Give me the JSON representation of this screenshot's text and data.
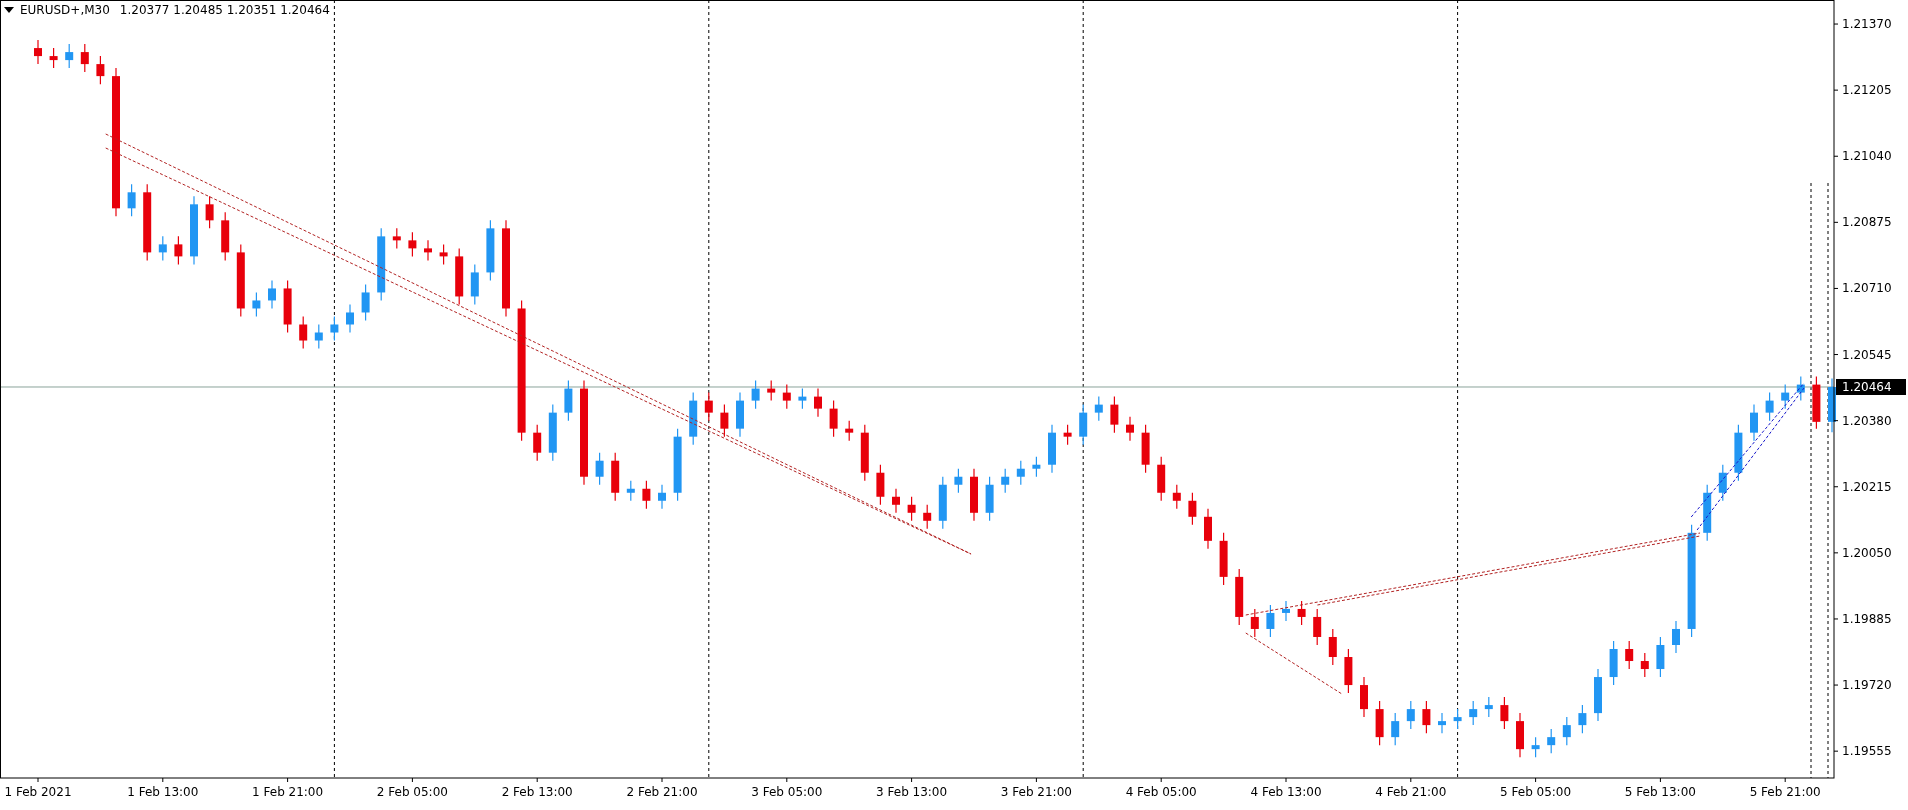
{
  "header": {
    "symbol": "EURUSD+,M30",
    "quotes": "1.20377 1.20485 1.20351 1.20464"
  },
  "chart_data": {
    "type": "candlestick",
    "ylim": [
      1.19488,
      1.2143
    ],
    "yticks": [
      {
        "value": 1.2137,
        "label": "1.21370"
      },
      {
        "value": 1.21205,
        "label": "1.21205"
      },
      {
        "value": 1.2104,
        "label": "1.21040"
      },
      {
        "value": 1.20875,
        "label": "1.20875"
      },
      {
        "value": 1.2071,
        "label": "1.20710"
      },
      {
        "value": 1.20545,
        "label": "1.20545"
      },
      {
        "value": 1.2038,
        "label": "1.20380"
      },
      {
        "value": 1.20215,
        "label": "1.20215"
      },
      {
        "value": 1.2005,
        "label": "1.20050"
      },
      {
        "value": 1.19885,
        "label": "1.19885"
      },
      {
        "value": 1.1972,
        "label": "1.19720"
      },
      {
        "value": 1.19555,
        "label": "1.19555"
      }
    ],
    "categories": [
      "1 Feb 2021",
      null,
      null,
      null,
      null,
      null,
      null,
      null,
      "1 Feb 13:00",
      null,
      null,
      null,
      null,
      null,
      null,
      null,
      "1 Feb 21:00",
      null,
      null,
      null,
      null,
      null,
      null,
      null,
      "2 Feb 05:00",
      null,
      null,
      null,
      null,
      null,
      null,
      null,
      "2 Feb 13:00",
      null,
      null,
      null,
      null,
      null,
      null,
      null,
      "2 Feb 21:00",
      null,
      null,
      null,
      null,
      null,
      null,
      null,
      "3 Feb 05:00",
      null,
      null,
      null,
      null,
      null,
      null,
      null,
      "3 Feb 13:00",
      null,
      null,
      null,
      null,
      null,
      null,
      null,
      "3 Feb 21:00",
      null,
      null,
      null,
      null,
      null,
      null,
      null,
      "4 Feb 05:00",
      null,
      null,
      null,
      null,
      null,
      null,
      null,
      "4 Feb 13:00",
      null,
      null,
      null,
      null,
      null,
      null,
      null,
      "4 Feb 21:00",
      null,
      null,
      null,
      null,
      null,
      null,
      null,
      "5 Feb 05:00",
      null,
      null,
      null,
      null,
      null,
      null,
      null,
      "5 Feb 13:00",
      null,
      null,
      null,
      null,
      null,
      null,
      null,
      "5 Feb 21:00",
      null,
      null,
      null
    ],
    "ohlc": [
      [
        1.2131,
        1.2133,
        1.2127,
        1.2129
      ],
      [
        1.2129,
        1.2131,
        1.2126,
        1.2128
      ],
      [
        1.2128,
        1.2132,
        1.2126,
        1.213
      ],
      [
        1.213,
        1.2132,
        1.2125,
        1.2127
      ],
      [
        1.2127,
        1.2129,
        1.2122,
        1.2124
      ],
      [
        1.2124,
        1.2126,
        1.2089,
        1.2091
      ],
      [
        1.2091,
        1.2097,
        1.2089,
        1.2095
      ],
      [
        1.2095,
        1.2097,
        1.2078,
        1.208
      ],
      [
        1.208,
        1.2084,
        1.2078,
        1.2082
      ],
      [
        1.2082,
        1.2084,
        1.2077,
        1.2079
      ],
      [
        1.2079,
        1.2094,
        1.2077,
        1.2092
      ],
      [
        1.2092,
        1.2094,
        1.2086,
        1.2088
      ],
      [
        1.2088,
        1.209,
        1.2078,
        1.208
      ],
      [
        1.208,
        1.2082,
        1.2064,
        1.2066
      ],
      [
        1.2066,
        1.207,
        1.2064,
        1.2068
      ],
      [
        1.2068,
        1.2073,
        1.2066,
        1.2071
      ],
      [
        1.2071,
        1.2073,
        1.206,
        1.2062
      ],
      [
        1.2062,
        1.2064,
        1.2056,
        1.2058
      ],
      [
        1.2058,
        1.2062,
        1.2056,
        1.206
      ],
      [
        1.206,
        1.2064,
        1.2058,
        1.2062
      ],
      [
        1.2062,
        1.2067,
        1.206,
        1.2065
      ],
      [
        1.2065,
        1.2072,
        1.2063,
        1.207
      ],
      [
        1.207,
        1.2086,
        1.2068,
        1.2084
      ],
      [
        1.2084,
        1.2086,
        1.2081,
        1.2083
      ],
      [
        1.2083,
        1.2085,
        1.2079,
        1.2081
      ],
      [
        1.2081,
        1.2083,
        1.2078,
        1.208
      ],
      [
        1.208,
        1.2082,
        1.2077,
        1.2079
      ],
      [
        1.2079,
        1.2081,
        1.2067,
        1.2069
      ],
      [
        1.2069,
        1.2077,
        1.2067,
        1.2075
      ],
      [
        1.2075,
        1.2088,
        1.2073,
        1.2086
      ],
      [
        1.2086,
        1.2088,
        1.2064,
        1.2066
      ],
      [
        1.2066,
        1.2068,
        1.2033,
        1.2035
      ],
      [
        1.2035,
        1.2037,
        1.2028,
        1.203
      ],
      [
        1.203,
        1.2042,
        1.2028,
        1.204
      ],
      [
        1.204,
        1.2048,
        1.2038,
        1.2046
      ],
      [
        1.2046,
        1.2048,
        1.2022,
        1.2024
      ],
      [
        1.2024,
        1.203,
        1.2022,
        1.2028
      ],
      [
        1.2028,
        1.203,
        1.2018,
        1.202
      ],
      [
        1.202,
        1.2023,
        1.2018,
        1.2021
      ],
      [
        1.2021,
        1.2023,
        1.2016,
        1.2018
      ],
      [
        1.2018,
        1.2022,
        1.2016,
        1.202
      ],
      [
        1.202,
        1.2036,
        1.2018,
        1.2034
      ],
      [
        1.2034,
        1.2045,
        1.2032,
        1.2043
      ],
      [
        1.2043,
        1.2045,
        1.2038,
        1.204
      ],
      [
        1.204,
        1.2042,
        1.2034,
        1.2036
      ],
      [
        1.2036,
        1.2045,
        1.2034,
        1.2043
      ],
      [
        1.2043,
        1.2048,
        1.2041,
        1.2046
      ],
      [
        1.2046,
        1.2048,
        1.2043,
        1.2045
      ],
      [
        1.2045,
        1.2047,
        1.2041,
        1.2043
      ],
      [
        1.2043,
        1.2046,
        1.2041,
        1.2044
      ],
      [
        1.2044,
        1.2046,
        1.2039,
        1.2041
      ],
      [
        1.2041,
        1.2043,
        1.2034,
        1.2036
      ],
      [
        1.2036,
        1.2038,
        1.2033,
        1.2035
      ],
      [
        1.2035,
        1.2037,
        1.2023,
        1.2025
      ],
      [
        1.2025,
        1.2027,
        1.2017,
        1.2019
      ],
      [
        1.2019,
        1.2021,
        1.2015,
        1.2017
      ],
      [
        1.2017,
        1.2019,
        1.2013,
        1.2015
      ],
      [
        1.2015,
        1.2017,
        1.2011,
        1.2013
      ],
      [
        1.2013,
        1.2024,
        1.2011,
        1.2022
      ],
      [
        1.2022,
        1.2026,
        1.202,
        1.2024
      ],
      [
        1.2024,
        1.2026,
        1.2013,
        1.2015
      ],
      [
        1.2015,
        1.2024,
        1.2013,
        1.2022
      ],
      [
        1.2022,
        1.2026,
        1.202,
        1.2024
      ],
      [
        1.2024,
        1.2028,
        1.2022,
        1.2026
      ],
      [
        1.2026,
        1.2029,
        1.2024,
        1.2027
      ],
      [
        1.2027,
        1.2037,
        1.2025,
        1.2035
      ],
      [
        1.2035,
        1.2037,
        1.2032,
        1.2034
      ],
      [
        1.2034,
        1.2042,
        1.2032,
        1.204
      ],
      [
        1.204,
        1.2044,
        1.2038,
        1.2042
      ],
      [
        1.2042,
        1.2044,
        1.2035,
        1.2037
      ],
      [
        1.2037,
        1.2039,
        1.2033,
        1.2035
      ],
      [
        1.2035,
        1.2037,
        1.2025,
        1.2027
      ],
      [
        1.2027,
        1.2029,
        1.2018,
        1.202
      ],
      [
        1.202,
        1.2022,
        1.2016,
        1.2018
      ],
      [
        1.2018,
        1.202,
        1.2012,
        1.2014
      ],
      [
        1.2014,
        1.2016,
        1.2006,
        1.2008
      ],
      [
        1.2008,
        1.201,
        1.1997,
        1.1999
      ],
      [
        1.1999,
        1.2001,
        1.1987,
        1.1989
      ],
      [
        1.1989,
        1.1991,
        1.1984,
        1.1986
      ],
      [
        1.1986,
        1.1992,
        1.1984,
        1.199
      ],
      [
        1.199,
        1.1993,
        1.1988,
        1.1991
      ],
      [
        1.1991,
        1.1993,
        1.1987,
        1.1989
      ],
      [
        1.1989,
        1.1991,
        1.1982,
        1.1984
      ],
      [
        1.1984,
        1.1986,
        1.1977,
        1.1979
      ],
      [
        1.1979,
        1.1981,
        1.197,
        1.1972
      ],
      [
        1.1972,
        1.1974,
        1.1964,
        1.1966
      ],
      [
        1.1966,
        1.1968,
        1.1957,
        1.1959
      ],
      [
        1.1959,
        1.1965,
        1.1957,
        1.1963
      ],
      [
        1.1963,
        1.1968,
        1.1961,
        1.1966
      ],
      [
        1.1966,
        1.1968,
        1.196,
        1.1962
      ],
      [
        1.1962,
        1.1965,
        1.196,
        1.1963
      ],
      [
        1.1963,
        1.1966,
        1.1961,
        1.1964
      ],
      [
        1.1964,
        1.1968,
        1.1962,
        1.1966
      ],
      [
        1.1966,
        1.1969,
        1.1964,
        1.1967
      ],
      [
        1.1967,
        1.1969,
        1.1961,
        1.1963
      ],
      [
        1.1963,
        1.1965,
        1.1954,
        1.1956
      ],
      [
        1.1956,
        1.1959,
        1.1954,
        1.1957
      ],
      [
        1.1957,
        1.1961,
        1.1955,
        1.1959
      ],
      [
        1.1959,
        1.1964,
        1.1957,
        1.1962
      ],
      [
        1.1962,
        1.1967,
        1.196,
        1.1965
      ],
      [
        1.1965,
        1.1976,
        1.1963,
        1.1974
      ],
      [
        1.1974,
        1.1983,
        1.1972,
        1.1981
      ],
      [
        1.1981,
        1.1983,
        1.1976,
        1.1978
      ],
      [
        1.1978,
        1.198,
        1.1974,
        1.1976
      ],
      [
        1.1976,
        1.1984,
        1.1974,
        1.1982
      ],
      [
        1.1982,
        1.1988,
        1.198,
        1.1986
      ],
      [
        1.1986,
        1.2012,
        1.1984,
        1.201
      ],
      [
        1.201,
        1.2022,
        1.2008,
        1.202
      ],
      [
        1.202,
        1.2027,
        1.2018,
        1.2025
      ],
      [
        1.2025,
        1.2037,
        1.2023,
        1.2035
      ],
      [
        1.2035,
        1.2042,
        1.2033,
        1.204
      ],
      [
        1.204,
        1.2045,
        1.2038,
        1.2043
      ],
      [
        1.2043,
        1.2047,
        1.2041,
        1.2045
      ],
      [
        1.2045,
        1.2049,
        1.2043,
        1.2047
      ],
      [
        1.2047,
        1.2049,
        1.2036,
        1.20377
      ],
      [
        1.20377,
        1.20485,
        1.20351,
        1.20464
      ]
    ],
    "grid": true,
    "ref_lines": [
      {
        "axis": "y",
        "value": 1.20464,
        "label": "1.20464"
      }
    ]
  }
}
